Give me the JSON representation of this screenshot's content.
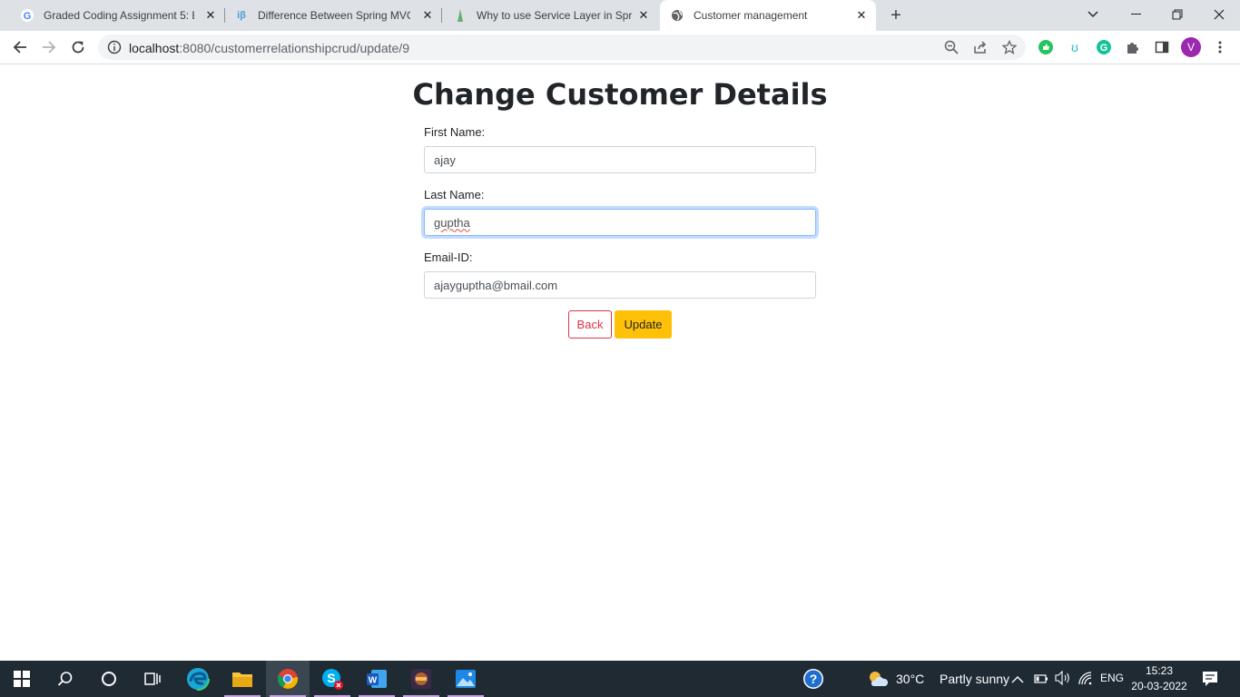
{
  "browser": {
    "tabs": [
      {
        "title": "Graded Coding Assignment 5: Ba",
        "favicon": "google-g-icon",
        "active": false
      },
      {
        "title": "Difference Between Spring MVC",
        "favicon": "interviewbit-icon",
        "active": false
      },
      {
        "title": "Why to use Service Layer in Sprin",
        "favicon": "baeldung-icon",
        "active": false
      },
      {
        "title": "Customer management",
        "favicon": "globe-icon",
        "active": true
      }
    ],
    "url_host": "localhost",
    "url_path": ":8080/customerrelationshipcrud/update/9",
    "profile_initial": "V"
  },
  "page": {
    "heading": "Change Customer Details",
    "first_name_label": "First Name:",
    "first_name_value": "ajay",
    "last_name_label": "Last Name:",
    "last_name_value": "guptha",
    "email_label": "Email-ID:",
    "email_value": "ajayguptha@bmail.com",
    "back_label": "Back",
    "update_label": "Update"
  },
  "taskbar": {
    "weather_temp": "30°C",
    "weather_desc": "Partly sunny",
    "language": "ENG",
    "time": "15:23",
    "date": "20-03-2022"
  },
  "colors": {
    "accent_update": "#ffc107",
    "accent_back": "#dc3545",
    "focus_ring": "#86b7fe",
    "profile": "#9c27b0"
  }
}
